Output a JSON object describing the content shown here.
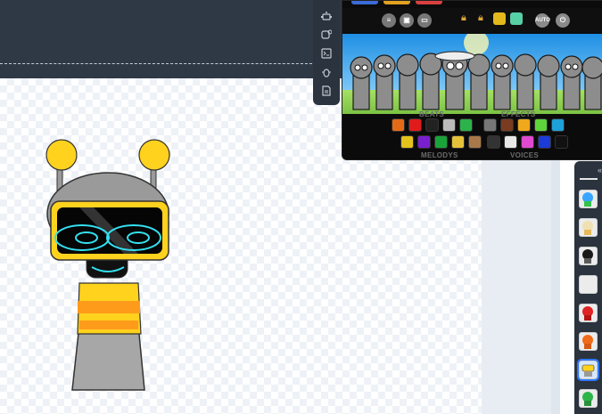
{
  "game": {
    "auto_label": "AUTO",
    "palette": {
      "beats_label": "BEATS",
      "effects_label": "EFFECTS",
      "melodys_label": "MELODYS",
      "voices_label": "VOICES"
    }
  },
  "icons": {
    "tools": [
      "robot-icon",
      "settings-person-icon",
      "terminal-icon",
      "bug-icon",
      "document-icon"
    ],
    "game_toolbar": [
      "menu-icon",
      "save-icon",
      "record-icon",
      "lock-icon",
      "lock-icon",
      "bonus-icon",
      "bonus-icon",
      "auto-icon",
      "reset-icon"
    ],
    "panel_collapse": "chevron-left-icon"
  },
  "colors": {
    "topbar": "#2f3945",
    "selected_thumb": "#2d77ff",
    "mascot_yellow": "#ffd21e",
    "visor_teal": "#33e0f0"
  }
}
